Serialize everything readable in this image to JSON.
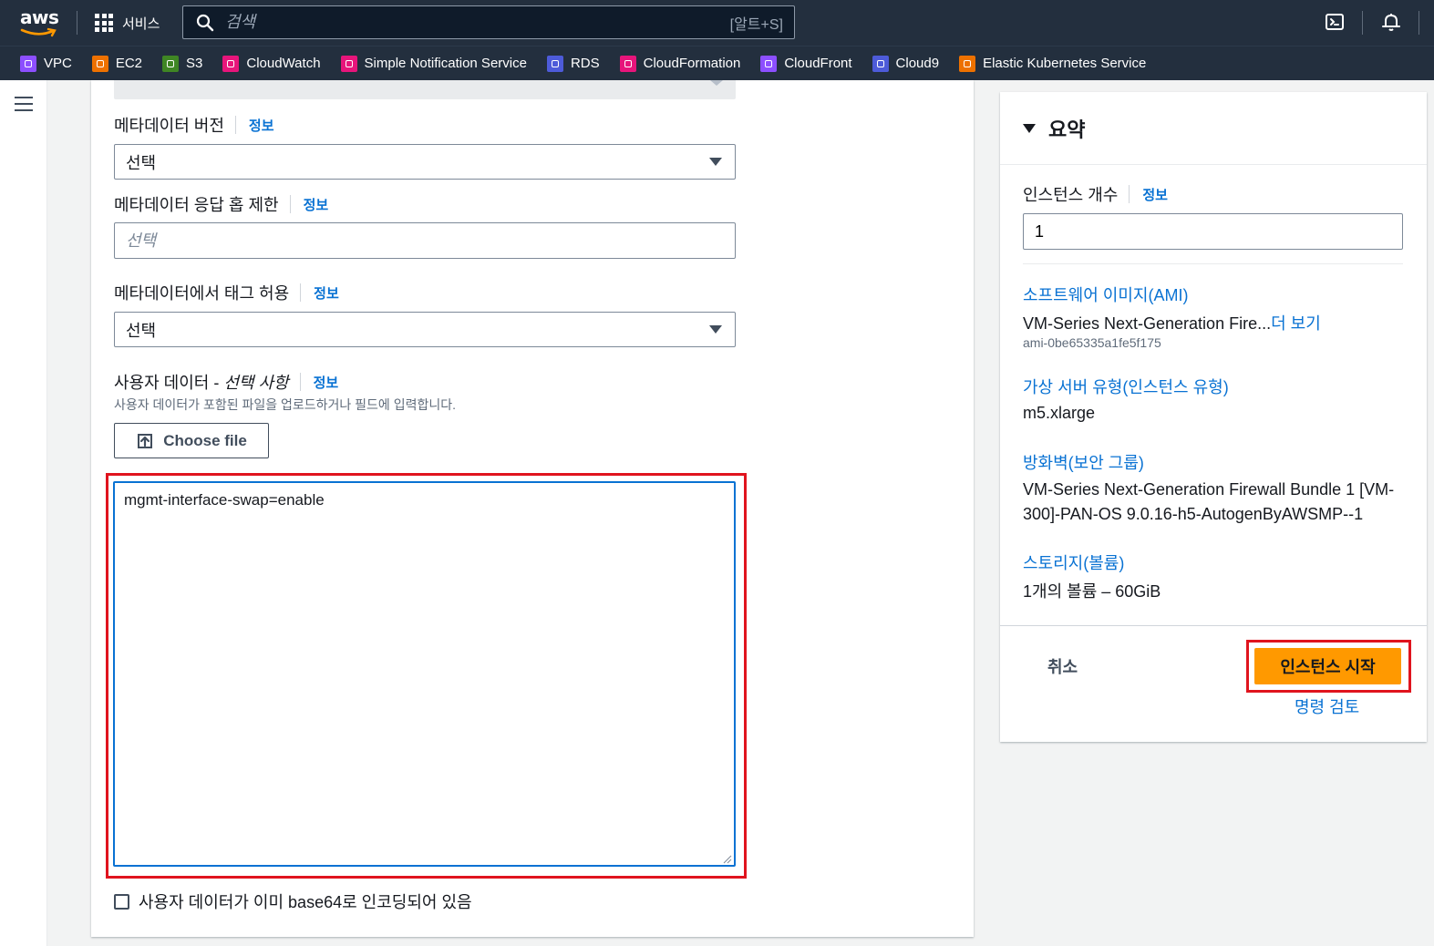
{
  "header": {
    "logo": "aws",
    "services_label": "서비스",
    "search_placeholder": "검색",
    "search_shortcut": "[알트+S]",
    "icons": [
      "cloudshell-icon",
      "notifications-icon"
    ]
  },
  "favorites": [
    {
      "label": "VPC",
      "color": "#8c4fff"
    },
    {
      "label": "EC2",
      "color": "#ed7100"
    },
    {
      "label": "S3",
      "color": "#3f8624"
    },
    {
      "label": "CloudWatch",
      "color": "#e7157b"
    },
    {
      "label": "Simple Notification Service",
      "color": "#e7157b"
    },
    {
      "label": "RDS",
      "color": "#4d5bd9"
    },
    {
      "label": "CloudFormation",
      "color": "#e7157b"
    },
    {
      "label": "CloudFront",
      "color": "#8c4fff"
    },
    {
      "label": "Cloud9",
      "color": "#4d5bd9"
    },
    {
      "label": "Elastic Kubernetes Service",
      "color": "#ed7100"
    }
  ],
  "form": {
    "metadata_version": {
      "label": "메타데이터 버전",
      "info": "정보",
      "value": "선택"
    },
    "metadata_hop_limit": {
      "label": "메타데이터 응답 홉 제한",
      "info": "정보",
      "placeholder": "선택"
    },
    "metadata_tags": {
      "label": "메타데이터에서 태그 허용",
      "info": "정보",
      "value": "선택"
    },
    "user_data": {
      "label": "사용자 데이터 - ",
      "label_optional": "선택 사항",
      "info": "정보",
      "description": "사용자 데이터가 포함된 파일을 업로드하거나 필드에 입력합니다.",
      "choose_file": "Choose file",
      "value": "mgmt-interface-swap=enable"
    },
    "base64_checkbox": {
      "label": "사용자 데이터가 이미 base64로 인코딩되어 있음",
      "checked": false
    }
  },
  "summary": {
    "title": "요약",
    "instance_count": {
      "label": "인스턴스 개수",
      "info": "정보",
      "value": "1"
    },
    "ami": {
      "link": "소프트웨어 이미지(AMI)",
      "value": "VM-Series Next-Generation Fire...",
      "more": "더 보기",
      "id": "ami-0be65335a1fe5f175"
    },
    "instance_type": {
      "link": "가상 서버 유형(인스턴스 유형)",
      "value": "m5.xlarge"
    },
    "security_group": {
      "link": "방화벽(보안 그룹)",
      "value": "VM-Series Next-Generation Firewall Bundle 1 [VM-300]-PAN-OS 9.0.16-h5-AutogenByAWSMP--1"
    },
    "storage": {
      "link": "스토리지(볼륨)",
      "value": "1개의 볼륨 – 60GiB"
    },
    "cancel": "취소",
    "launch": "인스턴스 시작",
    "review": "명령 검토"
  },
  "colors": {
    "nav_bg": "#232f3e",
    "link": "#0972d3",
    "primary_button": "#ff9900",
    "highlight": "#e0141e"
  }
}
